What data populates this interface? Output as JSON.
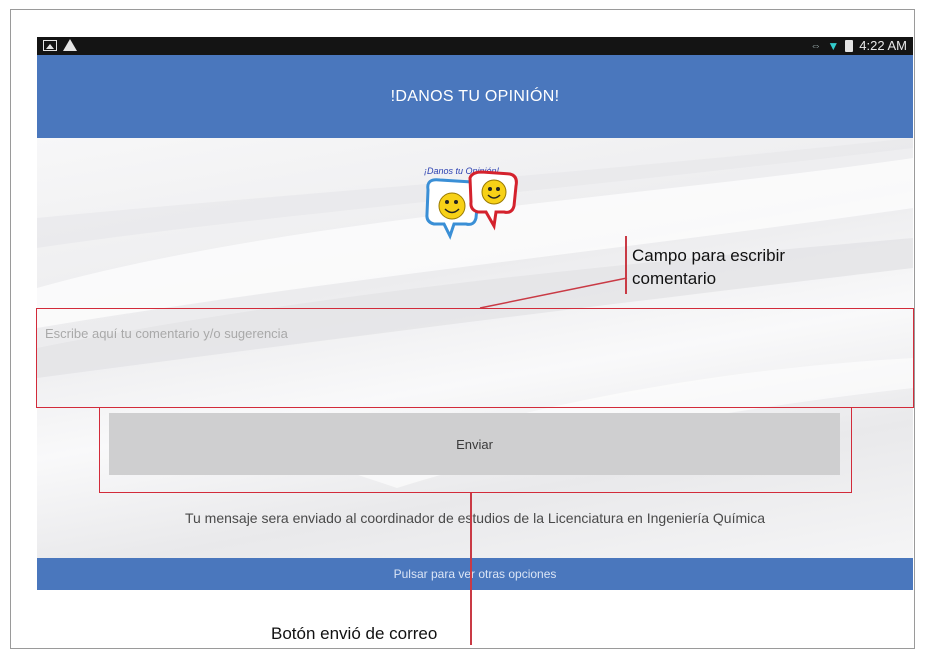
{
  "status_bar": {
    "time": "4:22 AM"
  },
  "app": {
    "header_title": "!DANOS TU OPINIÓN!",
    "logo_text": "¡Danos tu Opinión!",
    "comment_placeholder": "Escribe aquí tu comentario y/o sugerencia",
    "send_label": "Enviar",
    "info_text": "Tu mensaje sera enviado al coordinador de estudios de la Licenciatura en Ingeniería Química",
    "bottom_bar_label": "Pulsar para ver otras opciones"
  },
  "annotations": {
    "comment_field_label_line1": "Campo para escribir",
    "comment_field_label_line2": "comentario",
    "send_button_label": "Botón envió de correo"
  },
  "colors": {
    "header": "#4a77bd",
    "annotation": "#d22b3a",
    "button": "#cfcfd0"
  }
}
